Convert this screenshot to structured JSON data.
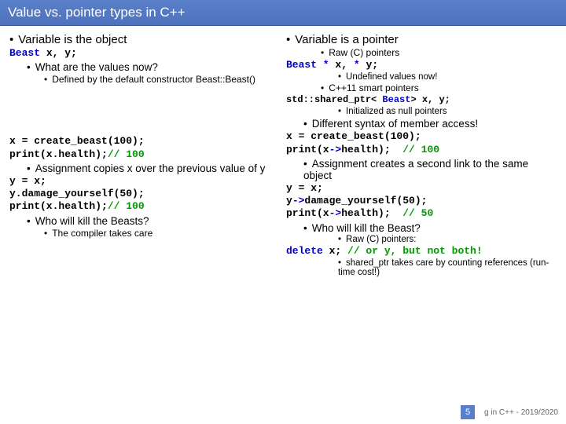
{
  "title": "Value vs. pointer types in C++",
  "left": {
    "h1": "Variable is the object",
    "code1a": "Beast",
    "code1b": " x, y;",
    "q1": "What are the values now?",
    "a1": "Defined by the default constructor Beast::Beast()",
    "code2a": "x = create_beast(100);",
    "code2b": "print(x.health);",
    "code2c": "// 100",
    "assign": "Assignment copies x over the previous value of y",
    "code3a": "y = x;",
    "code3b": "y.damage_yourself(50);",
    "code3c": "print(x.health);",
    "code3d": "// 100",
    "kill": "Who will kill the Beasts?",
    "killans": "The compiler takes care"
  },
  "right": {
    "h1": "Variable is a pointer",
    "rawc": "Raw (C) pointers",
    "code1a": "Beast *",
    "code1b": " x, ",
    "code1c": "*",
    "code1d": " y;",
    "undef": "Undefined values now!",
    "smart": "C++11 smart pointers",
    "code2a": "std::shared_ptr< ",
    "code2b": "Beast",
    "code2c": "> x, y;",
    "initnull": "Initialized as null pointers",
    "syntax": "Different syntax of member access!",
    "code3a": "x = create_beast(100);",
    "code3b": "print(x",
    "code3c": "->",
    "code3d": "health);",
    "code3e": "// 100",
    "assign": "Assignment creates a second link to the same object",
    "code4a": "y = x;",
    "code4b": "y",
    "code4c": "->",
    "code4d": "damage_yourself(50);",
    "code4e": "print(x",
    "code4f": "->",
    "code4g": "health);",
    "code4h": "  // 50",
    "kill": "Who will kill the Beast?",
    "rawptr": "Raw (C) pointers:",
    "code5a": "delete",
    "code5b": " x; ",
    "code5c": "// or y, but not both!",
    "sharedptr": "shared_ptr takes care by counting references (run-time cost!)"
  },
  "footer": {
    "pagenum": "5",
    "course": "g in C++ - 2019/2020"
  }
}
